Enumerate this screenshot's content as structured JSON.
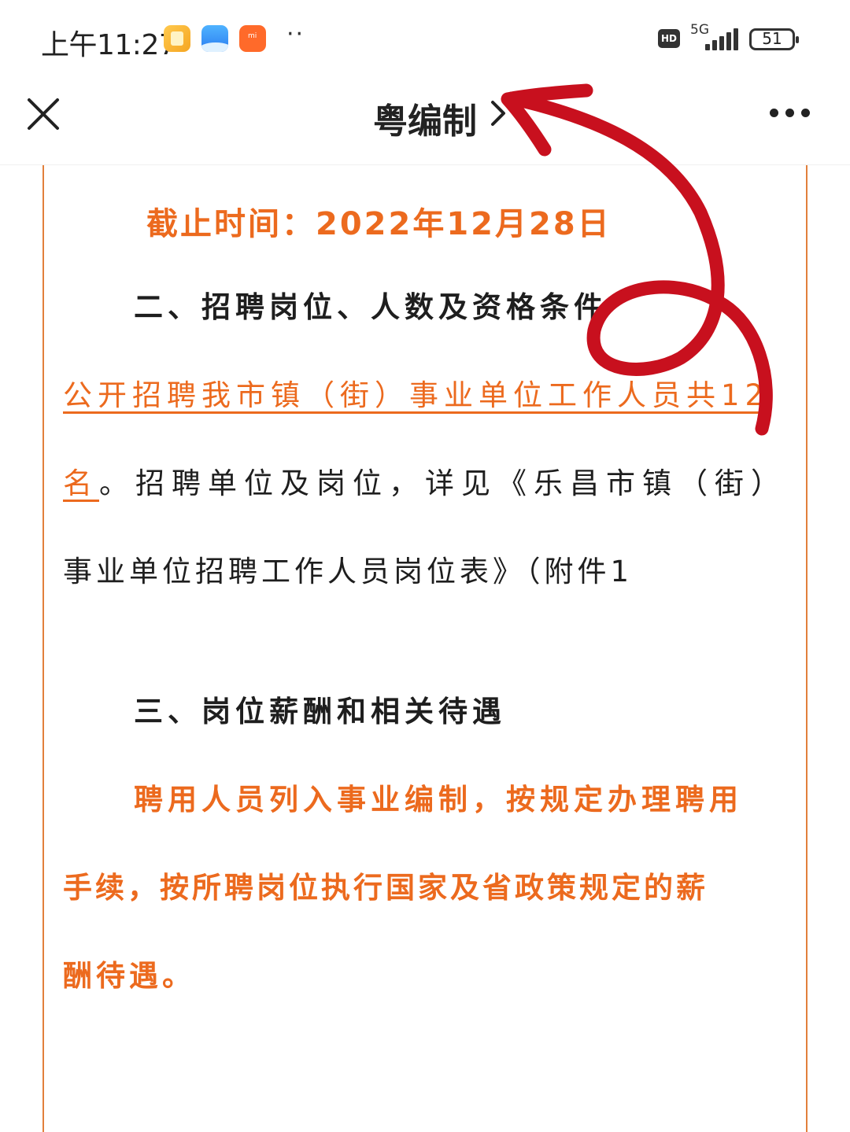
{
  "status_bar": {
    "time": "上午11:27",
    "dots": "··",
    "hd": "HD",
    "network": "5G",
    "battery": "51"
  },
  "nav": {
    "title": "粤编制",
    "chevron": "›"
  },
  "article": {
    "deadline": "截止时间：2022年12月28日",
    "section2_heading": "二、招聘岗位、人数及资格条件",
    "para1": {
      "line1_link": "公开招聘我市镇（街）事业单位工作人员共12",
      "line2_link": "名",
      "line2_text": "。招聘单位及岗位，详见《乐昌市镇（街）",
      "line3_text": "事业单位招聘工作人员岗位表》（附件1"
    },
    "section3_heading": "三、岗位薪酬和相关待遇",
    "para2": {
      "line1": "聘用人员列入事业编制，按规定办理聘用",
      "line2": "手续，按所聘岗位执行国家及省政策规定的薪",
      "line3": "酬待遇。"
    }
  },
  "colors": {
    "accent_orange": "#ec6a1e",
    "border_orange": "#e2803c",
    "annotation_red": "#c8101e"
  },
  "icons": [
    "close-icon",
    "chevron-right-icon",
    "more-icon",
    "signal-icon",
    "battery-icon"
  ]
}
